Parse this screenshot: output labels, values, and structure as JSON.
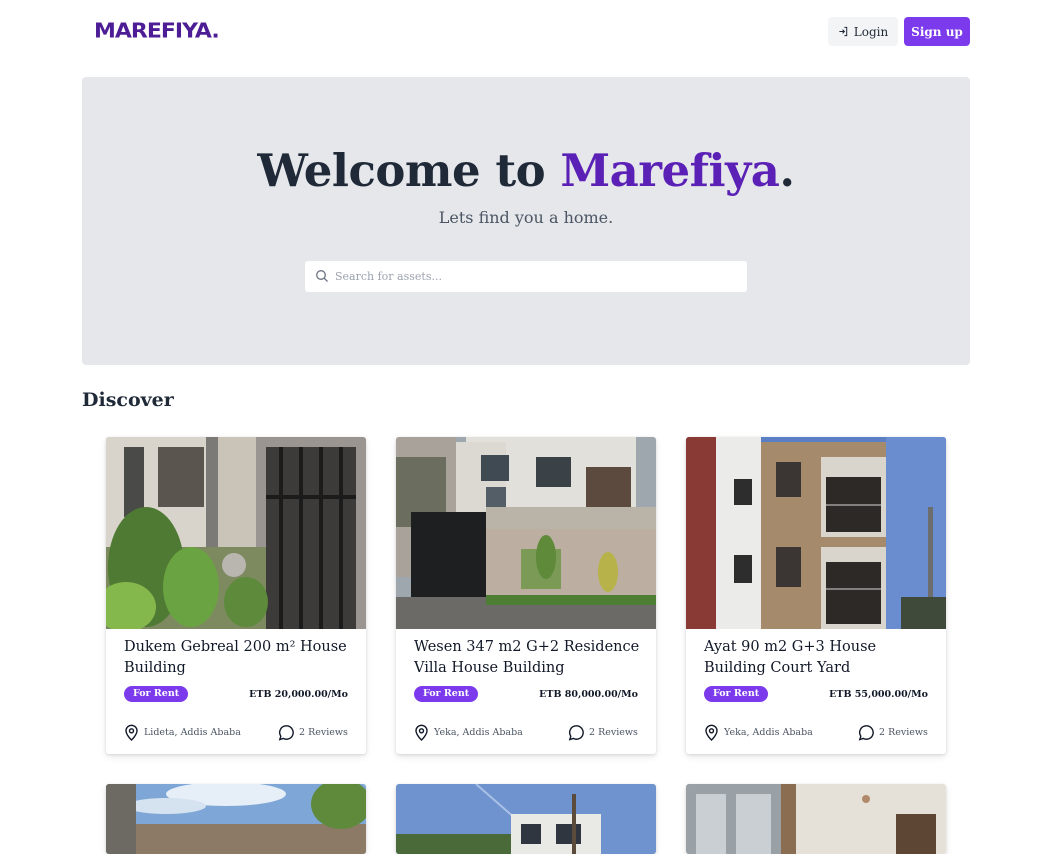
{
  "header": {
    "logo": "MAREFIYA.",
    "login_label": "Login",
    "signup_label": "Sign up"
  },
  "hero": {
    "title_prefix": "Welcome to ",
    "title_brand": "Marefiya",
    "title_suffix": ".",
    "subtitle": "Lets find you a home.",
    "search_placeholder": "Search for assets...",
    "search_value": ""
  },
  "discover": {
    "title": "Discover",
    "listings": [
      {
        "title": "Dukem Gebreal 200 m² House Building",
        "badge": "For Rent",
        "price": "ETB 20,000.00/Mo",
        "location": "Lideta, Addis Ababa",
        "reviews": "2 Reviews",
        "image": "house-entrance-plants-photo"
      },
      {
        "title": "Wesen 347 m2 G+2 Residence Villa House Building",
        "badge": "For Rent",
        "price": "ETB 80,000.00/Mo",
        "location": "Yeka, Addis Ababa",
        "reviews": "2 Reviews",
        "image": "villa-gate-photo"
      },
      {
        "title": "Ayat 90 m2 G+3 House Building Court Yard",
        "badge": "For Rent",
        "price": "ETB 55,000.00/Mo",
        "location": "Yeka, Addis Ababa",
        "reviews": "2 Reviews",
        "image": "stone-apartment-photo"
      }
    ],
    "partial_row_images": [
      "rooftop-sky-photo",
      "building-sky-photo",
      "interior-room-photo"
    ]
  },
  "colors": {
    "accent": "#7c3aed",
    "brand_dark": "#4c1d95",
    "hero_bg": "#e5e7eb",
    "text": "#1f2937"
  }
}
